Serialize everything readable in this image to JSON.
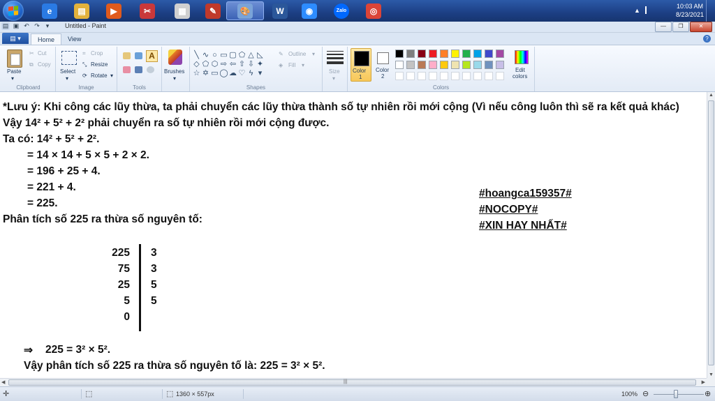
{
  "taskbar": {
    "apps": [
      {
        "name": "internet-explorer",
        "glyph": "e",
        "color": "#2a7ae4"
      },
      {
        "name": "file-explorer",
        "glyph": "▤",
        "color": "#e3b23c"
      },
      {
        "name": "media-player",
        "glyph": "▶",
        "color": "#e05a1c"
      },
      {
        "name": "snipping-tool",
        "glyph": "✂",
        "color": "#c9383a"
      },
      {
        "name": "app-5",
        "glyph": "▦",
        "color": "#d0d0d0"
      },
      {
        "name": "app-6",
        "glyph": "✎",
        "color": "#c0392b"
      },
      {
        "name": "paint",
        "glyph": "🎨",
        "color": "#7aa3d8"
      },
      {
        "name": "microsoft-word",
        "glyph": "W",
        "color": "#2b579a"
      },
      {
        "name": "zoom",
        "glyph": "◉",
        "color": "#2d8cff"
      },
      {
        "name": "zalo",
        "glyph": "Zalo",
        "color": "#0068ff"
      },
      {
        "name": "google-chrome",
        "glyph": "◎",
        "color": "#db4437"
      }
    ],
    "clock_time": "10:03 AM",
    "clock_date": "8/23/2021"
  },
  "window": {
    "title": "Untitled - Paint"
  },
  "ribbon": {
    "file_menu": "▤ ▾",
    "tabs": [
      "Home",
      "View"
    ],
    "clipboard": {
      "paste": "Paste",
      "cut": "Cut",
      "copy": "Copy",
      "label": "Clipboard"
    },
    "image": {
      "select": "Select",
      "crop": "Crop",
      "resize": "Resize",
      "rotate": "Rotate",
      "label": "Image"
    },
    "tools": {
      "label": "Tools"
    },
    "brushes": {
      "label": "Brushes"
    },
    "shapes": {
      "outline": "Outline",
      "fill": "Fill",
      "label": "Shapes"
    },
    "size": {
      "label": "Size"
    },
    "colors": {
      "color1": "Color",
      "color1_num": "1",
      "color2": "Color",
      "color2_num": "2",
      "edit": "Edit",
      "edit2": "colors",
      "label": "Colors",
      "palette_row1": [
        "#000000",
        "#7f7f7f",
        "#880015",
        "#ed1c24",
        "#ff7f27",
        "#fff200",
        "#22b14c",
        "#00a2e8",
        "#3f48cc",
        "#a349a4"
      ],
      "palette_row2": [
        "#ffffff",
        "#c3c3c3",
        "#b97a57",
        "#ffaec9",
        "#ffc90e",
        "#efe4b0",
        "#b5e61d",
        "#99d9ea",
        "#7092be",
        "#c8bfe7"
      ]
    }
  },
  "document": {
    "lines": [
      "*Lưu ý: Khi công các lũy thừa, ta phải chuyển các lũy thừa thành số tự nhiên rồi mới cộng (Vì nếu công luôn thì sẽ ra kết quả khác)",
      "Vậy 14² + 5² + 2² phải chuyển ra số tự nhiên rồi mới cộng được.",
      "Ta có: 14² + 5² + 2².",
      "= 14 × 14 + 5 × 5 + 2 × 2.",
      "= 196 + 25 + 4.",
      "= 221 + 4.",
      "= 225.",
      "Phân tích số 225 ra thừa số nguyên tố:"
    ],
    "tags": [
      "#hoangca159357#",
      "#NOCOPY#",
      "#XIN HAY NHẤT#"
    ],
    "factor_left": [
      "225",
      "75",
      "25",
      "5",
      "0"
    ],
    "factor_right": [
      "3",
      "3",
      "5",
      "5"
    ],
    "result_arrow": "⇒",
    "result": "225 = 3² × 5².",
    "conclusion": "Vậy phân tích số 225 ra thừa số nguyên tố là: 225 = 3² × 5²."
  },
  "statusbar": {
    "dimensions": "1360 × 557px",
    "zoom": "100%"
  }
}
